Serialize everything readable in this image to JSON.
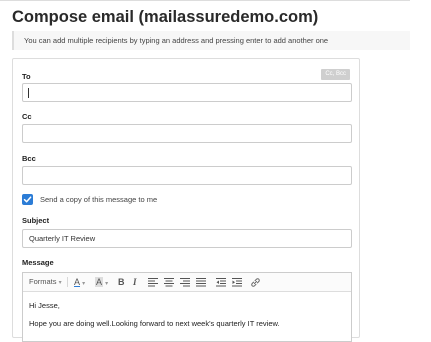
{
  "page": {
    "title": "Compose email (mailassuredemo.com)",
    "hint": "You can add multiple recipients by typing an address and pressing enter to add another one"
  },
  "form": {
    "to": {
      "label": "To",
      "value": "",
      "cc_bcc_toggle": "Cc, Bcc"
    },
    "cc": {
      "label": "Cc",
      "value": ""
    },
    "bcc": {
      "label": "Bcc",
      "value": ""
    },
    "send_copy": {
      "label": "Send a copy of this message to me",
      "checked": true
    },
    "subject": {
      "label": "Subject",
      "value": "Quarterly IT Review"
    },
    "message": {
      "label": "Message",
      "toolbar": {
        "formats_label": "Formats",
        "icons": [
          "text-color-icon",
          "background-color-icon",
          "bold-icon",
          "italic-icon",
          "align-left-icon",
          "align-center-icon",
          "align-right-icon",
          "justify-icon",
          "outdent-icon",
          "indent-icon",
          "link-icon"
        ],
        "bold": "B",
        "italic": "I",
        "text_color": "A",
        "background_color": "A"
      },
      "body_lines": [
        "Hi Jesse,",
        "Hope you are doing well.Looking forward to next week's quarterly IT review."
      ]
    }
  },
  "colors": {
    "accent": "#2b7cd6",
    "border": "#cccccc",
    "toggle_bg": "#cfcfcf"
  }
}
